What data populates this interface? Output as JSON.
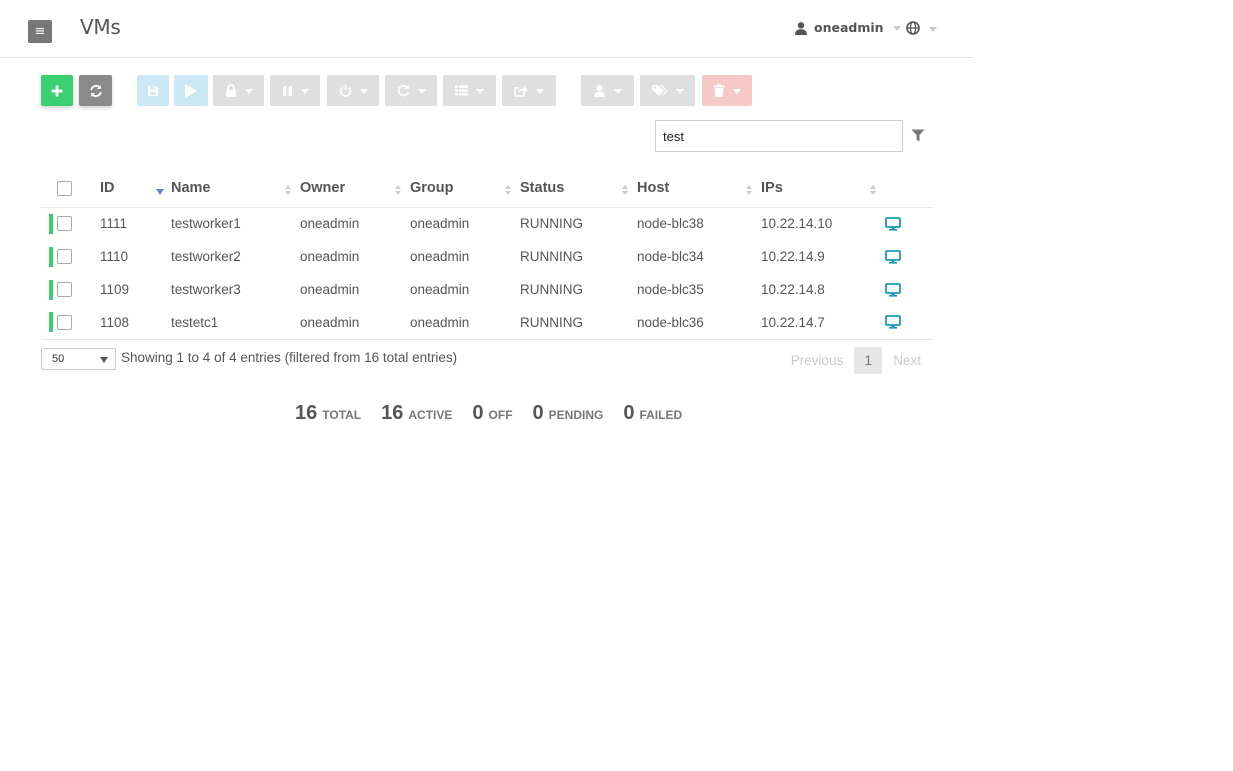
{
  "header": {
    "menu_icon": "hamburger-icon",
    "title": "VMs",
    "user_name": "oneadmin",
    "user_icon": "user-icon",
    "language_icon": "globe-icon"
  },
  "toolbar": {
    "buttons": [
      {
        "name": "create",
        "icon": "plus-icon",
        "color": "#3ad070"
      },
      {
        "name": "refresh",
        "icon": "refresh-icon",
        "color": "#8a8a8a"
      },
      {
        "name": "save",
        "icon": "save-icon",
        "color": "#cde8f5"
      },
      {
        "name": "play",
        "icon": "play-icon",
        "color": "#cde8f5"
      },
      {
        "name": "lock",
        "icon": "lock-icon"
      },
      {
        "name": "pause",
        "icon": "pause-icon"
      },
      {
        "name": "power",
        "icon": "power-icon"
      },
      {
        "name": "reboot",
        "icon": "reboot-icon"
      },
      {
        "name": "list",
        "icon": "list-icon"
      },
      {
        "name": "export",
        "icon": "share-icon"
      },
      {
        "name": "owner",
        "icon": "user-icon"
      },
      {
        "name": "labels",
        "icon": "tags-icon"
      },
      {
        "name": "delete",
        "icon": "trash-icon",
        "color": "#f6c9c9"
      }
    ]
  },
  "search": {
    "value": "test",
    "filter_icon": "filter-icon"
  },
  "table": {
    "columns": [
      "ID",
      "Name",
      "Owner",
      "Group",
      "Status",
      "Host",
      "IPs"
    ],
    "sorted_column": "ID",
    "rows": [
      {
        "id": "1111",
        "name": "testworker1",
        "owner": "oneadmin",
        "group": "oneadmin",
        "status": "RUNNING",
        "host": "node-blc38",
        "ips": "10.22.14.10"
      },
      {
        "id": "1110",
        "name": "testworker2",
        "owner": "oneadmin",
        "group": "oneadmin",
        "status": "RUNNING",
        "host": "node-blc34",
        "ips": "10.22.14.9"
      },
      {
        "id": "1109",
        "name": "testworker3",
        "owner": "oneadmin",
        "group": "oneadmin",
        "status": "RUNNING",
        "host": "node-blc35",
        "ips": "10.22.14.8"
      },
      {
        "id": "1108",
        "name": "testetc1",
        "owner": "oneadmin",
        "group": "oneadmin",
        "status": "RUNNING",
        "host": "node-blc36",
        "ips": "10.22.14.7"
      }
    ],
    "row_icon": "monitor-icon",
    "status_color": "#3ad070"
  },
  "footer": {
    "page_length": "50",
    "info": "Showing 1 to 4 of 4 entries (filtered from 16 total entries)",
    "previous": "Previous",
    "current_page": "1",
    "next": "Next"
  },
  "stats": [
    {
      "value": "16",
      "label": "TOTAL"
    },
    {
      "value": "16",
      "label": "ACTIVE"
    },
    {
      "value": "0",
      "label": "OFF"
    },
    {
      "value": "0",
      "label": "PENDING"
    },
    {
      "value": "0",
      "label": "FAILED"
    }
  ]
}
